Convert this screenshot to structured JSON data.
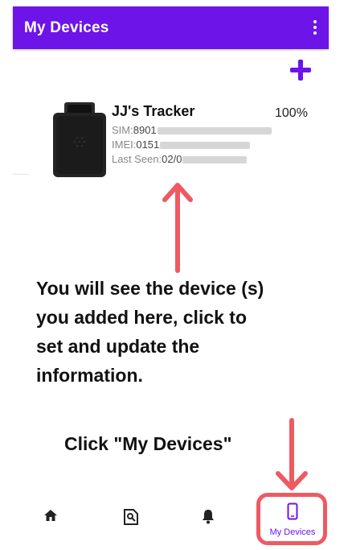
{
  "app_bar": {
    "title": "My Devices"
  },
  "device": {
    "name": "JJ's Tracker",
    "battery": "100%",
    "sim_label": "SIM:",
    "sim_visible": "8901",
    "imei_label": "IMEI:",
    "imei_visible": "0151",
    "last_seen_label": "Last Seen:",
    "last_seen_visible": "02/0"
  },
  "annotations": {
    "instruction_lines": [
      "You will see the device (s)",
      "you added here, click to",
      "set and update the",
      "information."
    ],
    "click_note": "Click \"My Devices\"",
    "arrow_color": "#ee5a62"
  },
  "bottom_nav": {
    "items": [
      {
        "icon": "home-icon"
      },
      {
        "icon": "map-icon"
      },
      {
        "icon": "bell-icon"
      },
      {
        "icon": "phone-icon",
        "label": "My Devices",
        "active": true
      }
    ]
  },
  "colors": {
    "primary": "#6d14e8",
    "highlight": "#ee5a62"
  }
}
